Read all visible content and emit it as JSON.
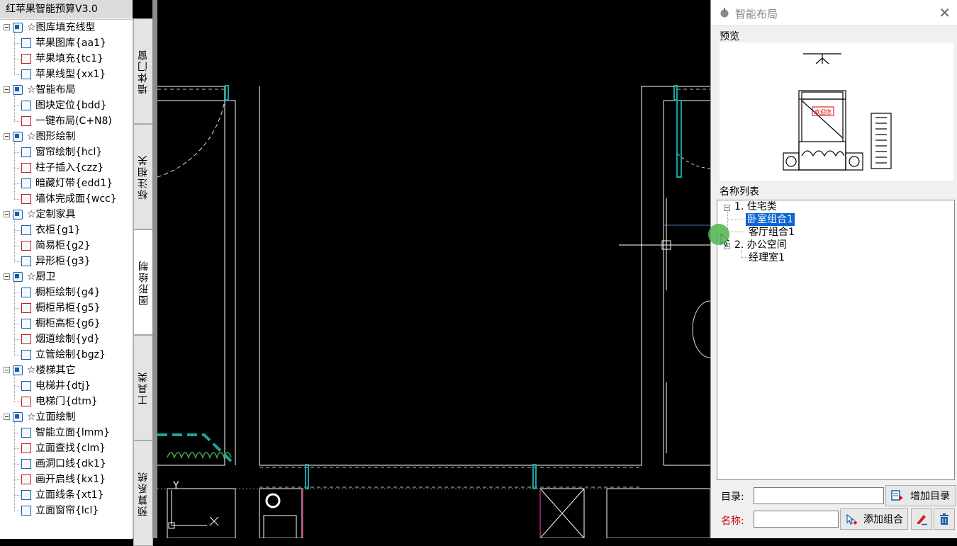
{
  "app": {
    "title": "红苹果智能预算V3.0"
  },
  "tool_tree": {
    "groups": [
      {
        "label": "☆图库填充线型",
        "items": [
          "苹果图库{aa1}",
          "苹果填充{tc1}",
          "苹果线型{xx1}"
        ]
      },
      {
        "label": "☆智能布局",
        "items": [
          "图块定位{bdd}",
          "一键布局(C+N8)"
        ]
      },
      {
        "label": "☆图形绘制",
        "items": [
          "窗帘绘制{hcl}",
          "柱子插入{czz}",
          "暗藏灯带{edd1}",
          "墙体完成面{wcc}"
        ]
      },
      {
        "label": "☆定制家具",
        "items": [
          "衣柜{g1}",
          "简易柜{g2}",
          "异形柜{g3}"
        ]
      },
      {
        "label": "☆厨卫",
        "items": [
          "橱柜绘制{g4}",
          "橱柜吊柜{g5}",
          "橱柜高柜{g6}",
          "烟道绘制{yd}",
          "立管绘制{bgz}"
        ]
      },
      {
        "label": "☆楼梯其它",
        "items": [
          "电梯井{dtj}",
          "电梯门{dtm}"
        ]
      },
      {
        "label": "☆立面绘制",
        "items": [
          "智能立面{lmm}",
          "立面查找{clm}",
          "画洞口线{dk1}",
          "画开启线{kx1}",
          "立面线条{xt1}",
          "立面窗帘{lcl}"
        ]
      }
    ]
  },
  "vtabs": [
    "墙体门窗",
    "标注相关",
    "图形绘制",
    "工具类",
    "预算系统"
  ],
  "vtab_active": "图形绘制",
  "panel": {
    "title": "智能布局",
    "close_glyph": "✕",
    "preview_label": "预览",
    "name_list_label": "名称列表",
    "preview_sign": "欢迎您",
    "tree": [
      {
        "label": "1. 住宅类",
        "children": [
          "卧室组合1",
          "客厅组合1"
        ]
      },
      {
        "label": "2. 办公空间",
        "children": [
          "经理室1"
        ]
      }
    ],
    "selected": "卧室组合1",
    "dir_label": "目录:",
    "dir_value": "",
    "add_dir_button": "增加目录",
    "name_label": "名称:",
    "name_value": "",
    "add_group_button": "添加组合"
  },
  "canvas": {
    "ucs_y": "Y"
  },
  "colors": {
    "accent_blue": "#0a64d4",
    "name_label_red": "#cc0000",
    "cad_cyan": "#1aa3a3",
    "cad_magenta": "#c0287a",
    "cad_green": "#4aa84a",
    "cursor_green": "#50b450"
  }
}
